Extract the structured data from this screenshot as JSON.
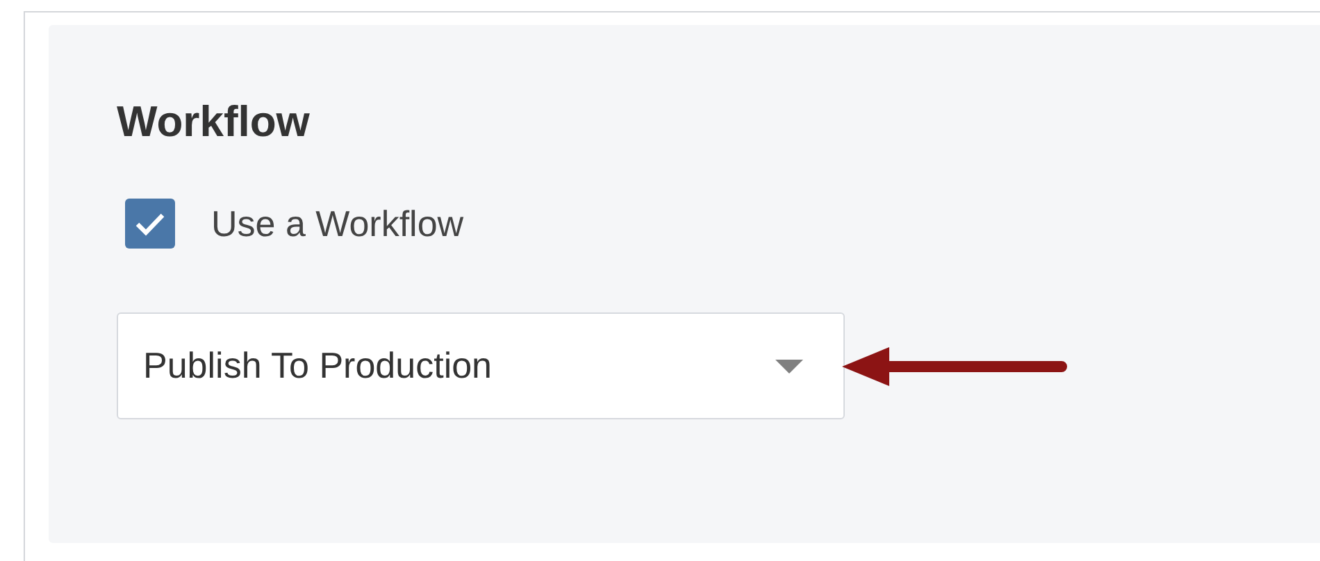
{
  "section": {
    "title": "Workflow"
  },
  "checkbox": {
    "label": "Use a Workflow",
    "checked": true
  },
  "select": {
    "value": "Publish To Production"
  }
}
